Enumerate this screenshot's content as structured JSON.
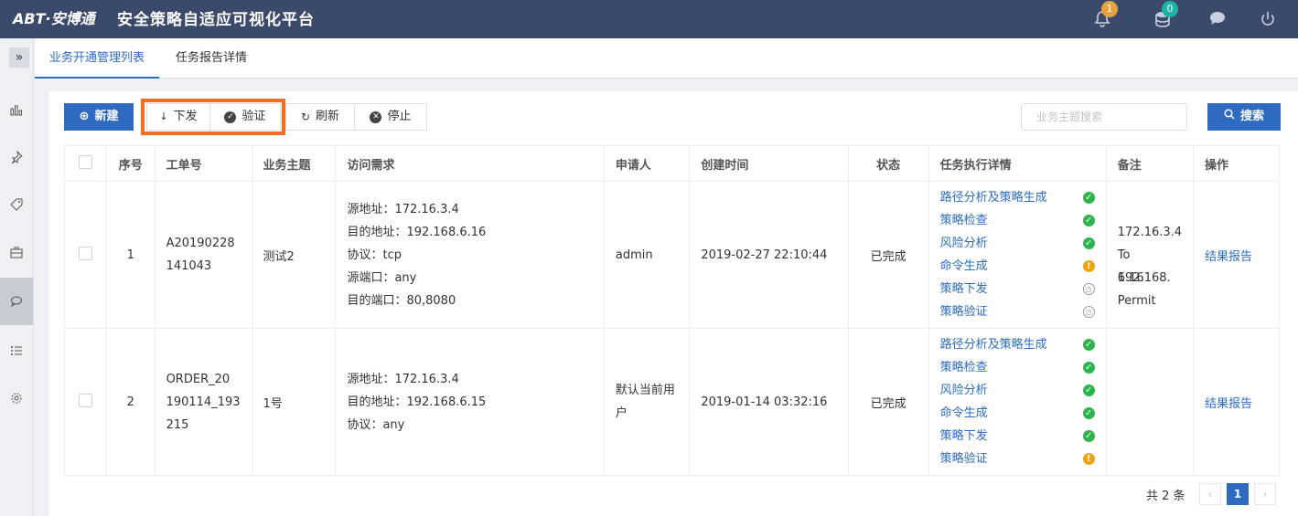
{
  "header": {
    "logo": "ABT·安博通",
    "title": "安全策略自适应可视化平台",
    "notifications_count": "1",
    "database_count": "0"
  },
  "tabs": [
    "业务开通管理列表",
    "任务报告详情"
  ],
  "toolbar": {
    "new": "新建",
    "deploy": "下发",
    "verify": "验证",
    "refresh": "刷新",
    "stop": "停止",
    "search_placeholder": "业务主题搜索",
    "search": "搜索"
  },
  "table": {
    "headers": [
      "序号",
      "工单号",
      "业务主题",
      "访问需求",
      "申请人",
      "创建时间",
      "状态",
      "任务执行详情",
      "备注",
      "操作"
    ],
    "rows": [
      {
        "index": "1",
        "order_no": [
          "A20190228",
          "141043"
        ],
        "subject": "测试2",
        "requirements": [
          "源地址：172.16.3.4",
          "目的地址：192.168.6.16",
          "协议：tcp",
          "源端口：any",
          "目的端口：80,8080"
        ],
        "applicant": [
          "admin"
        ],
        "created": "2019-02-27 22:10:44",
        "status": "已完成",
        "tasks": [
          {
            "name": "路径分析及策略生成",
            "state": "ok"
          },
          {
            "name": "策略检查",
            "state": "ok"
          },
          {
            "name": "风险分析",
            "state": "ok"
          },
          {
            "name": "命令生成",
            "state": "warn"
          },
          {
            "name": "策略下发",
            "state": "wait"
          },
          {
            "name": "策略验证",
            "state": "wait"
          }
        ],
        "remark": [
          "172.16.3.4",
          "To 192.168.",
          "6.16 Permit"
        ],
        "action": "结果报告"
      },
      {
        "index": "2",
        "order_no": [
          "ORDER_20",
          "190114_193",
          "215"
        ],
        "subject": "1号",
        "requirements": [
          "源地址：172.16.3.4",
          "目的地址：192.168.6.15",
          "协议：any"
        ],
        "applicant": [
          "默认当前用",
          "户"
        ],
        "created": "2019-01-14 03:32:16",
        "status": "已完成",
        "tasks": [
          {
            "name": "路径分析及策略生成",
            "state": "ok"
          },
          {
            "name": "策略检查",
            "state": "ok"
          },
          {
            "name": "风险分析",
            "state": "ok"
          },
          {
            "name": "命令生成",
            "state": "ok"
          },
          {
            "name": "策略下发",
            "state": "ok"
          },
          {
            "name": "策略验证",
            "state": "warn"
          }
        ],
        "remark": [],
        "action": "结果报告"
      }
    ]
  },
  "pagination": {
    "total": "共 2 条",
    "current": "1"
  }
}
